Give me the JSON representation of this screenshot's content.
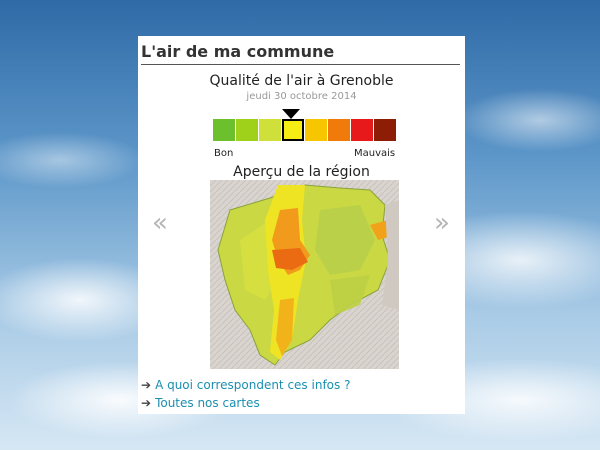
{
  "widget": {
    "title": "L'air de ma commune",
    "city_title": "Qualité de l'air à Grenoble",
    "date": "jeudi 30 octobre 2014",
    "scale": {
      "colors": [
        "#6cbf2d",
        "#9fd11a",
        "#cfe03a",
        "#f5ed14",
        "#f7c600",
        "#f07a0a",
        "#e8191a",
        "#8e1d06"
      ],
      "active_index": 3,
      "label_low": "Bon",
      "label_high": "Mauvais"
    },
    "region_title": "Aperçu de la région",
    "nav": {
      "prev_icon": "double-chevron-left-icon",
      "next_icon": "double-chevron-right-icon"
    },
    "links": [
      {
        "icon": "arrow-right-icon",
        "label": "A quoi correspondent ces infos ?"
      },
      {
        "icon": "arrow-right-icon",
        "label": "Toutes nos cartes"
      }
    ]
  }
}
